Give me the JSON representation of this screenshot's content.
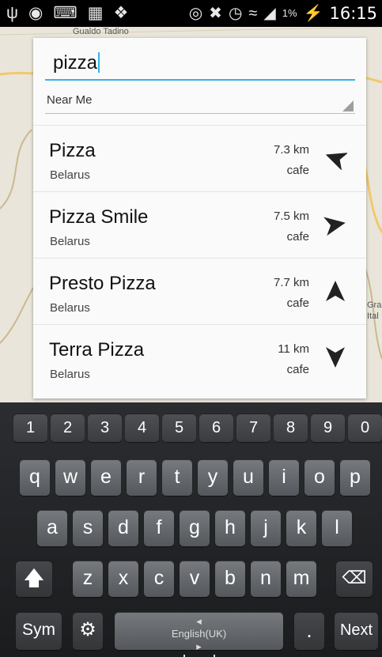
{
  "status_bar": {
    "time": "16:15",
    "battery": "1%",
    "icons": [
      "usb-icon",
      "gps-icon",
      "keyboard-icon",
      "sd-card-icon",
      "dropbox-icon",
      "vibrate-icon",
      "mute-icon",
      "alarm-icon",
      "wifi-icon",
      "signal-icon",
      "battery-charging-icon"
    ]
  },
  "map": {
    "labels": [
      "Gualdo Tadino",
      "Gra",
      "Ital"
    ]
  },
  "search": {
    "value": "pizza",
    "filter": "Near Me"
  },
  "results": [
    {
      "name": "Pizza",
      "country": "Belarus",
      "distance": "7.3 km",
      "type": "cafe",
      "arrow_rotation_deg": -70
    },
    {
      "name": "Pizza Smile",
      "country": "Belarus",
      "distance": "7.5 km",
      "type": "cafe",
      "arrow_rotation_deg": -80
    },
    {
      "name": "Presto Pizza",
      "country": "Belarus",
      "distance": "7.7 km",
      "type": "cafe",
      "arrow_rotation_deg": 0
    },
    {
      "name": "Terra Pizza",
      "country": "Belarus",
      "distance": "11 km",
      "type": "cafe",
      "arrow_rotation_deg": 180
    }
  ],
  "keyboard": {
    "numbers": [
      "1",
      "2",
      "3",
      "4",
      "5",
      "6",
      "7",
      "8",
      "9",
      "0"
    ],
    "row1": [
      "q",
      "w",
      "e",
      "r",
      "t",
      "y",
      "u",
      "i",
      "o",
      "p"
    ],
    "row2": [
      "a",
      "s",
      "d",
      "f",
      "g",
      "h",
      "j",
      "k",
      "l"
    ],
    "row3": [
      "z",
      "x",
      "c",
      "v",
      "b",
      "n",
      "m"
    ],
    "sym": "Sym",
    "space_label": "English(UK)",
    "period": ".",
    "next": "Next"
  },
  "colors": {
    "accent": "#33b5e5",
    "keyboard_bg": "#222326",
    "key_bg": "#67696d"
  }
}
